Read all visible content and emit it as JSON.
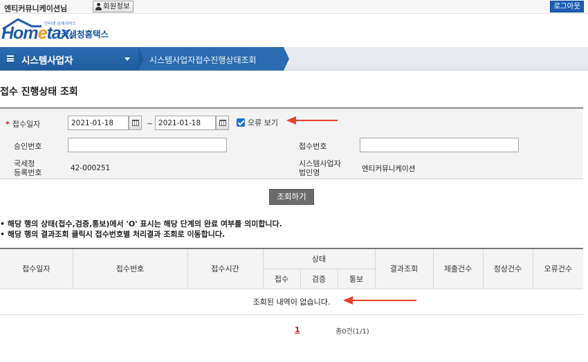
{
  "topbar": {
    "user_name": "엔티커뮤니케이션님",
    "member_info_label": "회원정보",
    "logout_label": "로그아웃"
  },
  "logo": {
    "tagline": "인터넷 납세서비스",
    "home": "Hom",
    "e": "e",
    "tax": "tax.",
    "korean": "국세청홈택스"
  },
  "nav": {
    "main_label": "시스템사업자",
    "sub_label": "시스템사업자접수진행상태조회"
  },
  "page_title": "접수 진행상태 조회",
  "search": {
    "required_mark": "*",
    "receipt_date_label": "접수일자",
    "date_from": "2021-01-18",
    "date_to": "2021-01-18",
    "tilde": "~",
    "show_errors_label": "오류 보기",
    "show_errors_checked": true,
    "approval_no_label": "승인번호",
    "approval_no_value": "",
    "receipt_no_label": "접수번호",
    "receipt_no_value": "",
    "nts_reg_label_1": "국세청",
    "nts_reg_label_2": "등록번호",
    "nts_reg_value": "42-000251",
    "corp_name_label_1": "시스템사업자",
    "corp_name_label_2": "법인명",
    "corp_name_value": "엔티커뮤니케이션",
    "search_button": "조회하기"
  },
  "notes": [
    "해당 행의 상태(접수,검증,통보)에서 'O' 표시는 해당 단계의 완료 여부를 의미합니다.",
    "해당 행의 결과조회 클릭시 접수번호별 처리결과 조회로 이동합니다."
  ],
  "table": {
    "col_receipt_date": "접수일자",
    "col_receipt_no": "접수번호",
    "col_receipt_time": "접수시간",
    "col_status": "상태",
    "col_status_receipt": "접수",
    "col_status_verify": "검증",
    "col_status_notice": "통보",
    "col_result": "결과조회",
    "col_submitted": "제출건수",
    "col_normal": "정상건수",
    "col_error": "오류건수",
    "empty_message": "조회된 내역이 없습니다."
  },
  "pager": {
    "current_page": "1",
    "total": "총0건(1/1)"
  },
  "colors": {
    "nav_blue": "#2b6bb0",
    "logout_blue": "#1e5fb4",
    "annotation_red": "#e8402a",
    "required_red": "#d81818"
  }
}
